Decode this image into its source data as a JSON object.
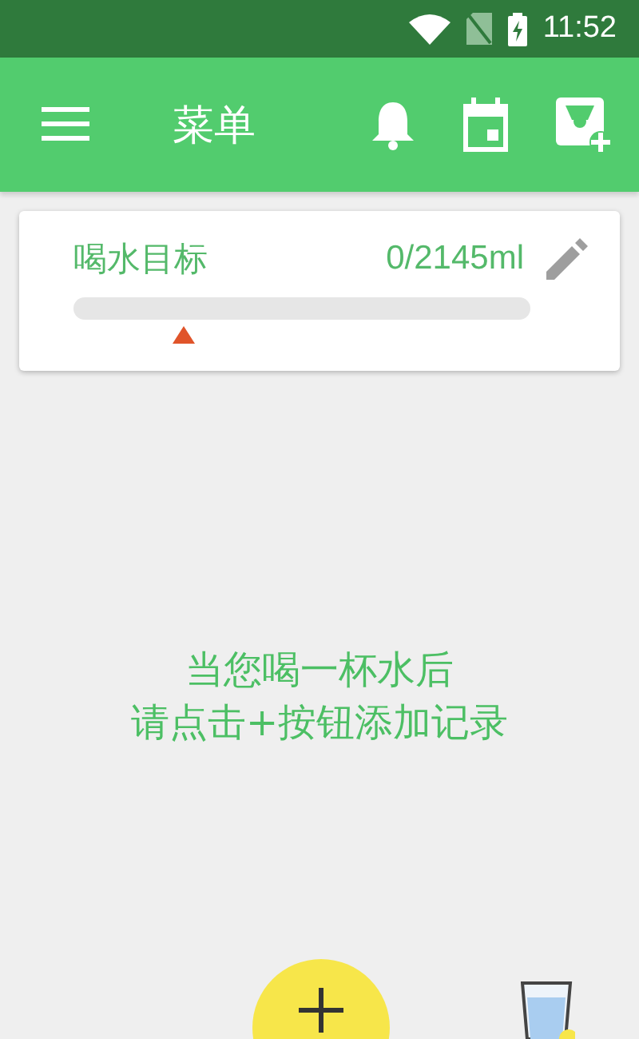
{
  "status_bar": {
    "time": "11:52"
  },
  "app_bar": {
    "title": "菜单"
  },
  "goal_card": {
    "title": "喝水目标",
    "amount": "0/2145ml",
    "progress": {
      "level": 0
    },
    "marker": {
      "level": 0.24
    }
  },
  "empty_message": {
    "lines": [
      "当您喝一杯水后",
      "请点击+按钮添加记录"
    ]
  }
}
